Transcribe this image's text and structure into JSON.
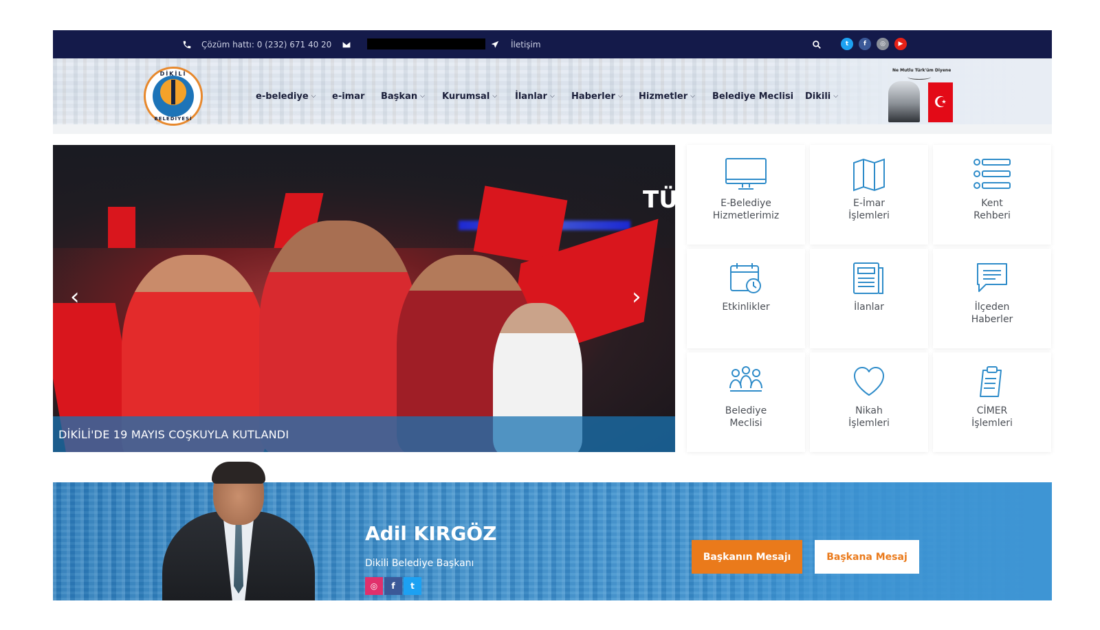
{
  "topbar": {
    "hotline": "Çözüm hattı: 0 (232) 671 40 20",
    "contact": "İletişim",
    "social": [
      "twitter-icon",
      "facebook-icon",
      "instagram-icon",
      "youtube-icon"
    ]
  },
  "header": {
    "logo_top": "DİKİLİ",
    "logo_bottom": "BELEDİYESİ",
    "nav": [
      {
        "label": "e-belediye",
        "dropdown": true
      },
      {
        "label": "e-imar",
        "dropdown": false
      },
      {
        "label": "Başkan",
        "dropdown": true
      },
      {
        "label": "Kurumsal",
        "dropdown": true
      },
      {
        "label": "İlanlar",
        "dropdown": true
      },
      {
        "label": "Haberler",
        "dropdown": true
      },
      {
        "label": "Hizmetler",
        "dropdown": true
      },
      {
        "label": "Belediye Meclisi",
        "dropdown": false
      },
      {
        "label": "Dikili",
        "dropdown": true
      }
    ],
    "motto": "Ne Mutlu Türk'üm Diyene"
  },
  "slider": {
    "caption": "DİKİLİ'DE 19 MAYIS COŞKUYLA KUTLANDI",
    "sign": "TÜ"
  },
  "tiles": [
    {
      "label_1": "E-Belediye",
      "label_2": "Hizmetlerimiz",
      "icon": "monitor-icon"
    },
    {
      "label_1": "E-İmar",
      "label_2": "İşlemleri",
      "icon": "map-icon"
    },
    {
      "label_1": "Kent",
      "label_2": "Rehberi",
      "icon": "list-icon"
    },
    {
      "label_1": "Etkinlikler",
      "label_2": "",
      "icon": "calendar-clock-icon"
    },
    {
      "label_1": "İlanlar",
      "label_2": "",
      "icon": "document-icon"
    },
    {
      "label_1": "İlçeden",
      "label_2": "Haberler",
      "icon": "message-icon"
    },
    {
      "label_1": "Belediye",
      "label_2": "Meclisi",
      "icon": "people-icon"
    },
    {
      "label_1": "Nikah",
      "label_2": "İşlemleri",
      "icon": "heart-icon"
    },
    {
      "label_1": "CİMER",
      "label_2": "İşlemleri",
      "icon": "clipboard-icon"
    }
  ],
  "mayor": {
    "name": "Adil KIRGÖZ",
    "title": "Dikili Belediye Başkanı",
    "primary_button": "Başkanın Mesajı",
    "secondary_button": "Başkana Mesaj"
  },
  "colors": {
    "topbar": "#141a4a",
    "accent_blue": "#2d8bc9",
    "accent_orange": "#ea7a1b",
    "tile_icon": "#2d8bc9"
  }
}
